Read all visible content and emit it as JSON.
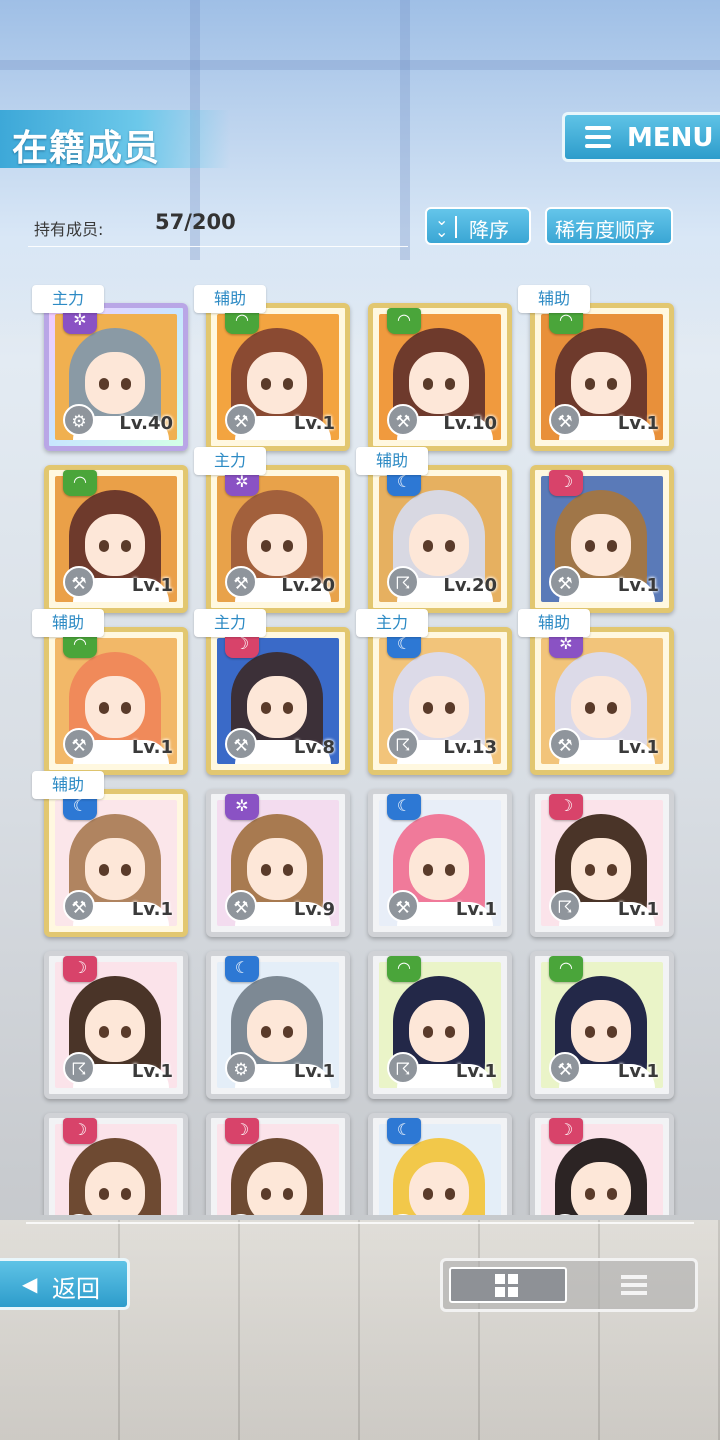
{
  "header": {
    "title": "在籍成员",
    "menu_label": "MENU",
    "member_count_label": "持有成员:",
    "member_count_value": "57/200",
    "sort_direction_label": "降序",
    "sort_key_label": "稀有度顺序"
  },
  "members": [
    {
      "role": "主力",
      "attr": "purple",
      "attr_icon": "purple-attribute-icon",
      "weapon_icon": "gear-icon",
      "level": "Lv.40",
      "frame": "rainbow",
      "hair": "#8a9aa5",
      "bg": "#f0b050"
    },
    {
      "role": "辅助",
      "attr": "green",
      "attr_icon": "green-attribute-icon",
      "weapon_icon": "wrench-icon",
      "level": "Lv.1",
      "frame": "gold",
      "hair": "#8a4a32",
      "bg": "#f3a440"
    },
    {
      "role": "",
      "attr": "green",
      "attr_icon": "green-attribute-icon",
      "weapon_icon": "wrench-icon",
      "level": "Lv.10",
      "frame": "gold",
      "hair": "#6e3a2c",
      "bg": "#f09a3e"
    },
    {
      "role": "辅助",
      "attr": "green",
      "attr_icon": "green-attribute-icon",
      "weapon_icon": "wrench-icon",
      "level": "Lv.1",
      "frame": "gold",
      "hair": "#6e3a2c",
      "bg": "#e8903a"
    },
    {
      "role": "",
      "attr": "green",
      "attr_icon": "green-attribute-icon",
      "weapon_icon": "wrench-icon",
      "level": "Lv.1",
      "frame": "gold",
      "hair": "#6e3a2c",
      "bg": "#eaa048"
    },
    {
      "role": "主力",
      "attr": "purple",
      "attr_icon": "purple-attribute-icon",
      "weapon_icon": "hammer-icon",
      "level": "Lv.20",
      "frame": "gold",
      "hair": "#a2603c",
      "bg": "#e8a24a"
    },
    {
      "role": "辅助",
      "attr": "blue",
      "attr_icon": "blue-attribute-icon",
      "weapon_icon": "scythe-icon",
      "level": "Lv.20",
      "frame": "gold",
      "hair": "#d8d8e2",
      "bg": "#e6b060"
    },
    {
      "role": "",
      "attr": "pink",
      "attr_icon": "pink-attribute-icon",
      "weapon_icon": "wrench-icon",
      "level": "Lv.1",
      "frame": "gold",
      "hair": "#a07648",
      "bg": "#5a7ab8"
    },
    {
      "role": "辅助",
      "attr": "green",
      "attr_icon": "green-attribute-icon",
      "weapon_icon": "hammer-icon",
      "level": "Lv.1",
      "frame": "gold",
      "hair": "#f08a5a",
      "bg": "#f2b868"
    },
    {
      "role": "主力",
      "attr": "pink",
      "attr_icon": "pink-attribute-icon",
      "weapon_icon": "wrench-icon",
      "level": "Lv.8",
      "frame": "gold",
      "hair": "#3c3038",
      "bg": "#3a6ac8"
    },
    {
      "role": "主力",
      "attr": "blue",
      "attr_icon": "blue-attribute-icon",
      "weapon_icon": "scythe-icon",
      "level": "Lv.13",
      "frame": "gold",
      "hair": "#dcdae8",
      "bg": "#f2c47a"
    },
    {
      "role": "辅助",
      "attr": "purple",
      "attr_icon": "purple-attribute-icon",
      "weapon_icon": "wrench-icon",
      "level": "Lv.1",
      "frame": "gold",
      "hair": "#dcdae8",
      "bg": "#f2c47a"
    },
    {
      "role": "辅助",
      "attr": "blue",
      "attr_icon": "blue-attribute-icon",
      "weapon_icon": "wrench-icon",
      "level": "Lv.1",
      "frame": "gold",
      "hair": "#b08460",
      "bg": "#fbe6ea"
    },
    {
      "role": "",
      "attr": "purple",
      "attr_icon": "purple-attribute-icon",
      "weapon_icon": "wrench-icon",
      "level": "Lv.9",
      "frame": "silver",
      "hair": "#a87a50",
      "bg": "#f3dcef"
    },
    {
      "role": "",
      "attr": "blue",
      "attr_icon": "blue-attribute-icon",
      "weapon_icon": "hammer-icon",
      "level": "Lv.1",
      "frame": "silver",
      "hair": "#f07a9a",
      "bg": "#e8eef8"
    },
    {
      "role": "",
      "attr": "pink",
      "attr_icon": "pink-attribute-icon",
      "weapon_icon": "scythe-icon",
      "level": "Lv.1",
      "frame": "silver",
      "hair": "#4a3428",
      "bg": "#fbe3ea"
    },
    {
      "role": "",
      "attr": "pink",
      "attr_icon": "pink-attribute-icon",
      "weapon_icon": "scythe-icon",
      "level": "Lv.1",
      "frame": "silver",
      "hair": "#4a3428",
      "bg": "#fbe3ea"
    },
    {
      "role": "",
      "attr": "blue",
      "attr_icon": "blue-attribute-icon",
      "weapon_icon": "gear-icon",
      "level": "Lv.1",
      "frame": "silver",
      "hair": "#7d8994",
      "bg": "#e4eef8"
    },
    {
      "role": "",
      "attr": "green",
      "attr_icon": "green-attribute-icon",
      "weapon_icon": "scythe-icon",
      "level": "Lv.1",
      "frame": "silver",
      "hair": "#232848",
      "bg": "#eaf4c8"
    },
    {
      "role": "",
      "attr": "green",
      "attr_icon": "green-attribute-icon",
      "weapon_icon": "wrench-icon",
      "level": "Lv.1",
      "frame": "silver",
      "hair": "#232848",
      "bg": "#eaf4c8"
    },
    {
      "role": "",
      "attr": "pink",
      "attr_icon": "pink-attribute-icon",
      "weapon_icon": "wrench-icon",
      "level": "",
      "frame": "silver",
      "hair": "#6e4a32",
      "bg": "#fbe3ea"
    },
    {
      "role": "",
      "attr": "pink",
      "attr_icon": "pink-attribute-icon",
      "weapon_icon": "wrench-icon",
      "level": "",
      "frame": "silver",
      "hair": "#6e4a32",
      "bg": "#fbe3ea"
    },
    {
      "role": "",
      "attr": "blue",
      "attr_icon": "blue-attribute-icon",
      "weapon_icon": "wrench-icon",
      "level": "",
      "frame": "silver",
      "hair": "#f2c84a",
      "bg": "#e4eef8"
    },
    {
      "role": "",
      "attr": "pink",
      "attr_icon": "pink-attribute-icon",
      "weapon_icon": "wrench-icon",
      "level": "",
      "frame": "silver",
      "hair": "#2c2424",
      "bg": "#fbe3ea"
    }
  ],
  "footer": {
    "back_label": "返回",
    "view_grid_icon": "grid-view-icon",
    "view_list_icon": "list-view-icon"
  }
}
